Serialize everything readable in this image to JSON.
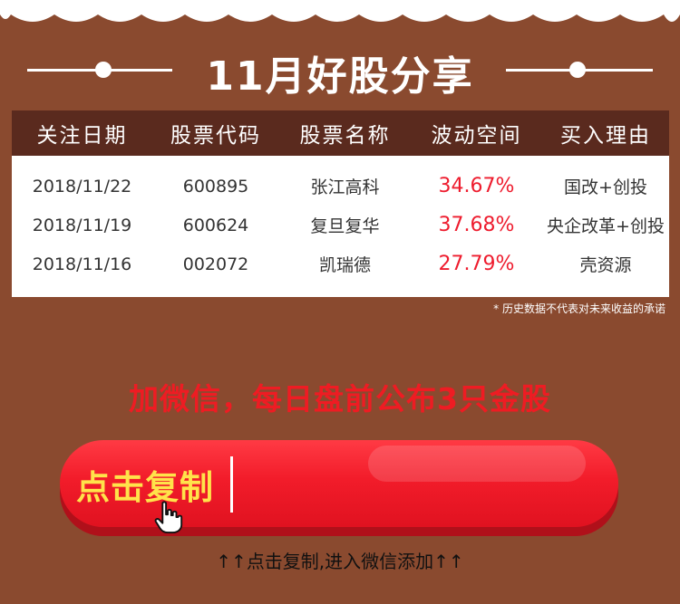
{
  "header": {
    "title": "11月好股分享"
  },
  "table": {
    "columns": [
      "关注日期",
      "股票代码",
      "股票名称",
      "波动空间",
      "买入理由"
    ],
    "rows": [
      {
        "date": "2018/11/22",
        "code": "600895",
        "name": "张江高科",
        "change": "34.67%",
        "reason": "国改+创投"
      },
      {
        "date": "2018/11/19",
        "code": "600624",
        "name": "复旦复华",
        "change": "37.68%",
        "reason": "央企改革+创投"
      },
      {
        "date": "2018/11/16",
        "code": "002072",
        "name": "凯瑞德",
        "change": "27.79%",
        "reason": "壳资源"
      }
    ]
  },
  "disclaimer": "* 历史数据不代表对未来收益的承诺",
  "promo": {
    "text": "加微信，每日盘前公布3只金股"
  },
  "copy_button": {
    "label": "点击复制"
  },
  "bottom_tip": "↑↑点击复制,进入微信添加↑↑",
  "colors": {
    "background": "#8a4a2f",
    "header_bar": "#5a2a1e",
    "accent_red": "#ee1c2e",
    "button_label": "#ffe34a"
  },
  "icons": {
    "cursor": "hand-pointer-icon"
  }
}
